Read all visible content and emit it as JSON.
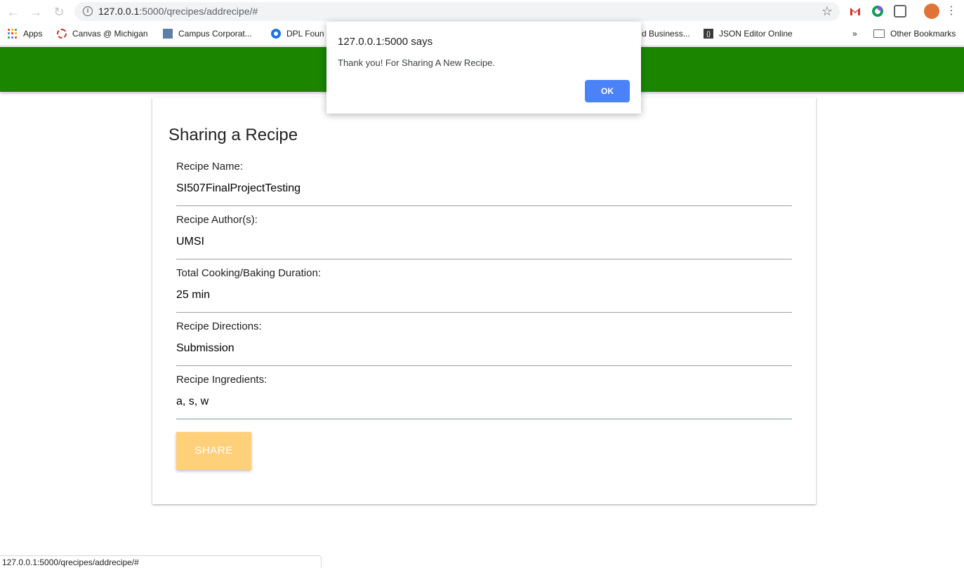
{
  "browser": {
    "url_host": "127.0.0.1",
    "url_rest": ":5000/qrecipes/addrecipe/#",
    "bookmarks": [
      {
        "label": "Apps"
      },
      {
        "label": "Canvas @ Michigan"
      },
      {
        "label": "Campus Corporat..."
      },
      {
        "label": "DPL Foun"
      },
      {
        "label": "d Business..."
      },
      {
        "label": "JSON Editor Online"
      }
    ],
    "overflow": "»",
    "other_bookmarks": "Other Bookmarks",
    "status_url": "127.0.0.1:5000/qrecipes/addrecipe/#"
  },
  "dialog": {
    "title": "127.0.0.1:5000 says",
    "message": "Thank you! For Sharing A New Recipe.",
    "ok_label": "OK"
  },
  "form": {
    "title": "Sharing a Recipe",
    "fields": [
      {
        "label": "Recipe Name:",
        "value": "SI507FinalProjectTesting"
      },
      {
        "label": "Recipe Author(s):",
        "value": "UMSI"
      },
      {
        "label": "Total Cooking/Baking Duration:",
        "value": "25 min"
      },
      {
        "label": "Recipe Directions:",
        "value": "Submission"
      },
      {
        "label": "Recipe Ingredients:",
        "value": "a, s, w"
      }
    ],
    "submit_label": "SHARE"
  },
  "colors": {
    "header_green": "#1b8500",
    "share_button": "#ffd07a",
    "dialog_ok": "#4c82f7"
  }
}
